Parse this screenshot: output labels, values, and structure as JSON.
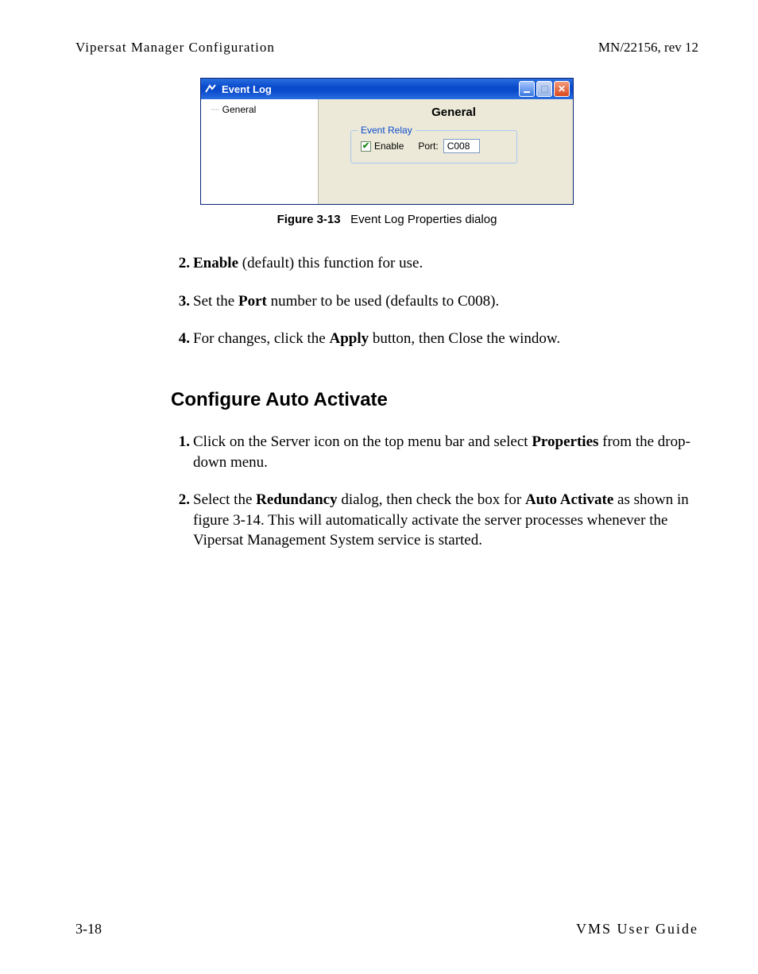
{
  "header": {
    "left": "Vipersat Manager Configuration",
    "right": "MN/22156, rev 12"
  },
  "dialog": {
    "title": "Event Log",
    "tree_item": "General",
    "content_title": "General",
    "group": {
      "legend": "Event Relay",
      "enable_label": "Enable",
      "enable_checked": true,
      "port_label": "Port:",
      "port_value": "C008"
    }
  },
  "figure": {
    "label": "Figure 3-13",
    "caption": "Event Log Properties dialog"
  },
  "steps_a": [
    {
      "num": "2.",
      "parts": [
        {
          "t": "Enable",
          "b": true
        },
        {
          "t": " (default) this function for use."
        }
      ]
    },
    {
      "num": "3.",
      "parts": [
        {
          "t": "Set the "
        },
        {
          "t": "Port",
          "b": true
        },
        {
          "t": " number to be used (defaults to C008)."
        }
      ]
    },
    {
      "num": "4.",
      "parts": [
        {
          "t": "For changes, click the "
        },
        {
          "t": "Apply",
          "b": true
        },
        {
          "t": " button, then Close the window."
        }
      ]
    }
  ],
  "section_heading": "Configure Auto Activate",
  "steps_b": [
    {
      "num": "1.",
      "parts": [
        {
          "t": "Click on the Server icon on the top menu bar and select "
        },
        {
          "t": "Properties",
          "b": true
        },
        {
          "t": " from the drop-down menu."
        }
      ]
    },
    {
      "num": "2.",
      "parts": [
        {
          "t": "Select the "
        },
        {
          "t": "Redundancy",
          "b": true
        },
        {
          "t": " dialog, then check the box for "
        },
        {
          "t": "Auto Activate",
          "b": true
        },
        {
          "t": " as shown in figure 3-14. This will automatically activate the server processes whenever the Vipersat Management System service is started."
        }
      ]
    }
  ],
  "footer": {
    "left": "3-18",
    "right": "VMS User Guide"
  }
}
